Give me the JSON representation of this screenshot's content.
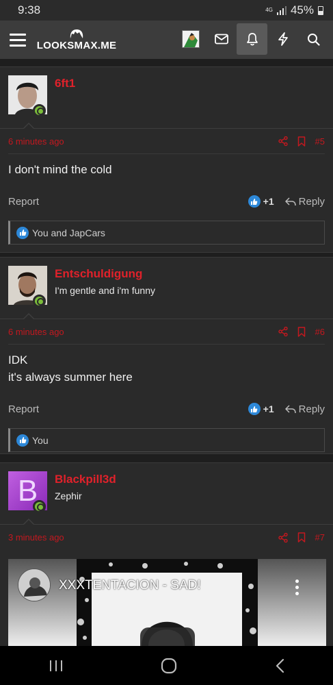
{
  "status": {
    "time": "9:38",
    "network": "4G",
    "battery": "45%"
  },
  "header": {
    "logo_text": "LOOKSMAX.ME"
  },
  "posts": [
    {
      "username": "6ft1",
      "user_title": "",
      "time": "6 minutes ago",
      "number": "#5",
      "body_lines": [
        "I don't mind the cold"
      ],
      "report": "Report",
      "like_count": "+1",
      "reply": "Reply",
      "likes_text": "You and JapCars"
    },
    {
      "username": "Entschuldigung",
      "user_title": "I'm gentle and i'm funny",
      "time": "6 minutes ago",
      "number": "#6",
      "body_lines": [
        "IDK",
        "it's always summer here"
      ],
      "report": "Report",
      "like_count": "+1",
      "reply": "Reply",
      "likes_text": "You"
    },
    {
      "username": "Blackpill3d",
      "user_title": "Zephir",
      "time": "3 minutes ago",
      "number": "#7",
      "avatar_letter": "B",
      "video_title": "XXXTENTACION - SAD!"
    }
  ],
  "colors": {
    "username": "#e0212a",
    "timestamp": "#c4181f",
    "like": "#2d88d8",
    "online": "#7bbd3a"
  }
}
